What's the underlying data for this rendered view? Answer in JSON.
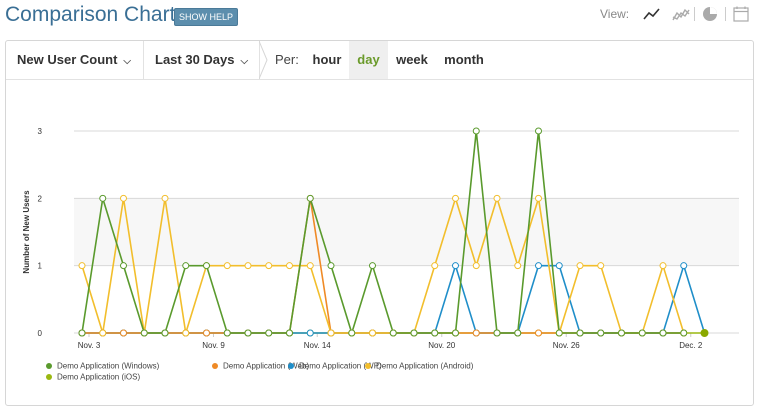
{
  "header": {
    "title": "Comparison Chart",
    "help_label": "SHOW HELP",
    "view_label": "View:",
    "view_icons": [
      "line-chart-icon",
      "area-chart-icon",
      "pie-chart-icon",
      "calendar-icon"
    ]
  },
  "toolbar": {
    "metric": "New User Count",
    "range": "Last 30 Days",
    "per_label": "Per:",
    "periods": [
      "hour",
      "day",
      "week",
      "month"
    ],
    "active_period": "day"
  },
  "chart_data": {
    "type": "line",
    "ylabel": "Number of New Users",
    "ylim": [
      0,
      3
    ],
    "yticks": [
      "0",
      "1",
      "2",
      "3"
    ],
    "x": [
      "Nov. 3",
      "Nov. 4",
      "Nov. 5",
      "Nov. 6",
      "Nov. 7",
      "Nov. 8",
      "Nov. 9",
      "Nov. 10",
      "Nov. 11",
      "Nov. 12",
      "Nov. 13",
      "Nov. 14",
      "Nov. 15",
      "Nov. 16",
      "Nov. 17",
      "Nov. 18",
      "Nov. 19",
      "Nov. 20",
      "Nov. 21",
      "Nov. 22",
      "Nov. 23",
      "Nov. 24",
      "Nov. 25",
      "Nov. 26",
      "Nov. 27",
      "Nov. 28",
      "Nov. 29",
      "Nov. 30",
      "Dec. 1",
      "Dec. 2",
      "Dec. 3"
    ],
    "xtick_labels": [
      "Nov. 3",
      "Nov. 9",
      "Nov. 14",
      "Nov. 20",
      "Nov. 26",
      "Dec. 2"
    ],
    "grid": true,
    "legend": "bottom",
    "series": [
      {
        "name": "Demo Application (Windows)",
        "color": "#5a9a2d",
        "values": [
          0,
          2,
          1,
          0,
          0,
          1,
          1,
          0,
          0,
          0,
          0,
          2,
          1,
          0,
          1,
          0,
          0,
          0,
          0,
          3,
          0,
          0,
          3,
          0,
          0,
          0,
          0,
          0,
          0,
          0,
          null
        ]
      },
      {
        "name": "Demo Application (Web)",
        "color": "#ef8a26",
        "values": [
          0,
          0,
          0,
          0,
          0,
          0,
          0,
          0,
          0,
          0,
          0,
          2,
          0,
          0,
          0,
          0,
          0,
          0,
          0,
          0,
          0,
          0,
          0,
          0,
          0,
          0,
          0,
          0,
          0,
          0,
          null
        ]
      },
      {
        "name": "Demo Application (WP)",
        "color": "#1f8ec9",
        "values": [
          0,
          0,
          0,
          0,
          0,
          0,
          0,
          0,
          0,
          0,
          0,
          0,
          0,
          0,
          0,
          0,
          0,
          0,
          1,
          0,
          0,
          0,
          1,
          1,
          0,
          0,
          0,
          0,
          0,
          1,
          0
        ]
      },
      {
        "name": "Demo Application (Android)",
        "color": "#f2be2c",
        "values": [
          1,
          0,
          2,
          0,
          2,
          0,
          1,
          1,
          1,
          1,
          1,
          1,
          0,
          0,
          0,
          0,
          0,
          1,
          2,
          1,
          2,
          1,
          2,
          0,
          1,
          1,
          0,
          0,
          1,
          0,
          null
        ]
      },
      {
        "name": "Demo Application (iOS)",
        "color": "#9ab810",
        "values": [
          0,
          0,
          0,
          0,
          0,
          0,
          0,
          0,
          0,
          0,
          0,
          0,
          0,
          0,
          0,
          0,
          0,
          0,
          0,
          0,
          0,
          0,
          0,
          0,
          0,
          0,
          0,
          0,
          0,
          0,
          0
        ]
      }
    ]
  }
}
